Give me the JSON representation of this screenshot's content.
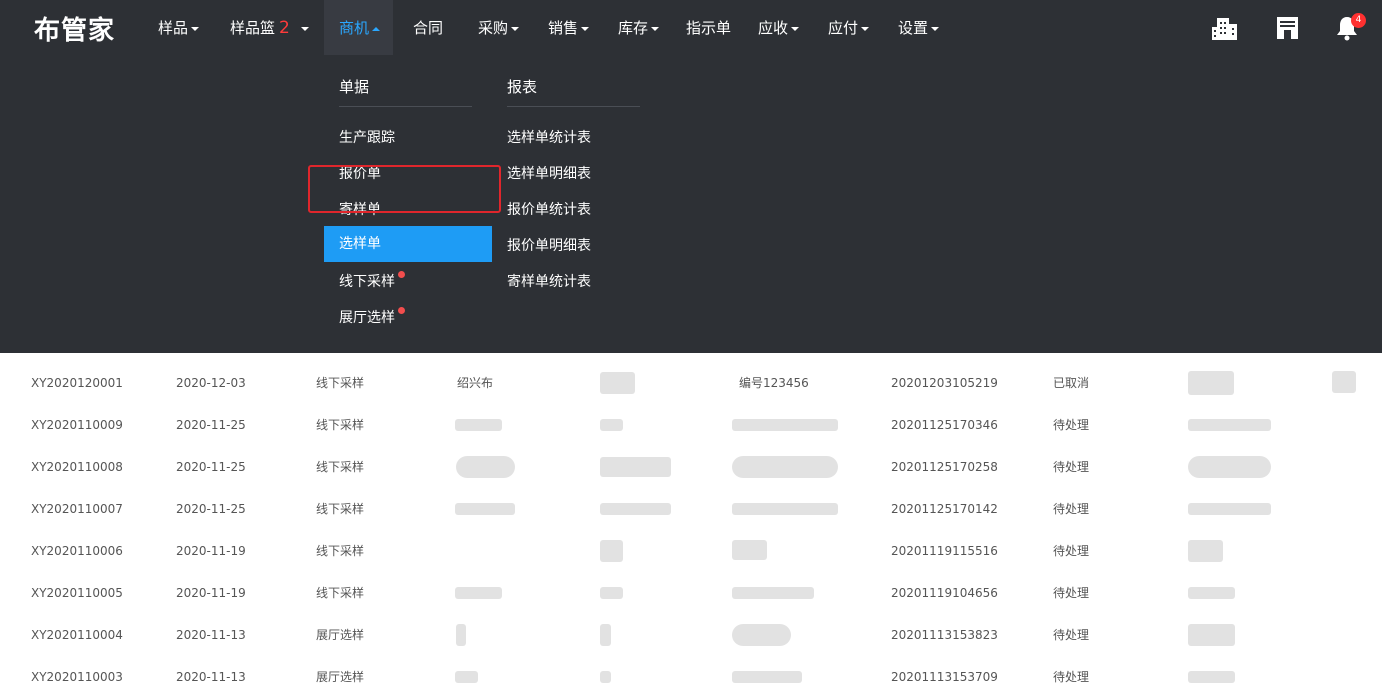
{
  "app": {
    "logo": "布管家"
  },
  "nav": {
    "items": [
      {
        "label": "样品",
        "has_caret": true
      },
      {
        "label": "样品篮",
        "badge": "2",
        "has_caret": true
      },
      {
        "label": "商机",
        "has_caret": true,
        "active": true
      },
      {
        "label": "合同",
        "has_caret": false
      },
      {
        "label": "采购",
        "has_caret": true
      },
      {
        "label": "销售",
        "has_caret": true
      },
      {
        "label": "库存",
        "has_caret": true
      },
      {
        "label": "指示单",
        "has_caret": false
      },
      {
        "label": "应收",
        "has_caret": true
      },
      {
        "label": "应付",
        "has_caret": true
      },
      {
        "label": "设置",
        "has_caret": true
      }
    ],
    "icons": [
      "company-icon",
      "store-icon",
      "bell-icon"
    ],
    "notification_count": "4",
    "accent_color": "#2aa7ff"
  },
  "dropdown": {
    "documents": {
      "title": "单据",
      "items": [
        "生产跟踪",
        "报价单",
        "寄样单",
        "选样单",
        "线下采样",
        "展厅选样"
      ],
      "selected": "选样单",
      "dotted": [
        "线下采样",
        "展厅选样"
      ]
    },
    "reports": {
      "title": "报表",
      "items": [
        "选样单统计表",
        "选样单明细表",
        "报价单统计表",
        "报价单明细表",
        "寄样单统计表"
      ]
    }
  },
  "table": {
    "rows": [
      {
        "no": "XY2020120001",
        "date": "2020-12-03",
        "type": "线下采样",
        "c4": "绍兴布",
        "c6": "编号123456",
        "code": "20201203105219",
        "status": "已取消"
      },
      {
        "no": "XY2020110009",
        "date": "2020-11-25",
        "type": "线下采样",
        "c4": "",
        "c6": "",
        "code": "20201125170346",
        "status": "待处理"
      },
      {
        "no": "XY2020110008",
        "date": "2020-11-25",
        "type": "线下采样",
        "c4": "",
        "c6": "",
        "code": "20201125170258",
        "status": "待处理"
      },
      {
        "no": "XY2020110007",
        "date": "2020-11-25",
        "type": "线下采样",
        "c4": "",
        "c6": "",
        "code": "20201125170142",
        "status": "待处理"
      },
      {
        "no": "XY2020110006",
        "date": "2020-11-19",
        "type": "线下采样",
        "c4": "",
        "c6": "",
        "code": "20201119115516",
        "status": "待处理"
      },
      {
        "no": "XY2020110005",
        "date": "2020-11-19",
        "type": "线下采样",
        "c4": "",
        "c6": "",
        "code": "20201119104656",
        "status": "待处理"
      },
      {
        "no": "XY2020110004",
        "date": "2020-11-13",
        "type": "展厅选样",
        "c4": "",
        "c6": "",
        "code": "20201113153823",
        "status": "待处理"
      },
      {
        "no": "XY2020110003",
        "date": "2020-11-13",
        "type": "展厅选样",
        "c4": "",
        "c6": "",
        "code": "20201113153709",
        "status": "待处理"
      }
    ]
  }
}
